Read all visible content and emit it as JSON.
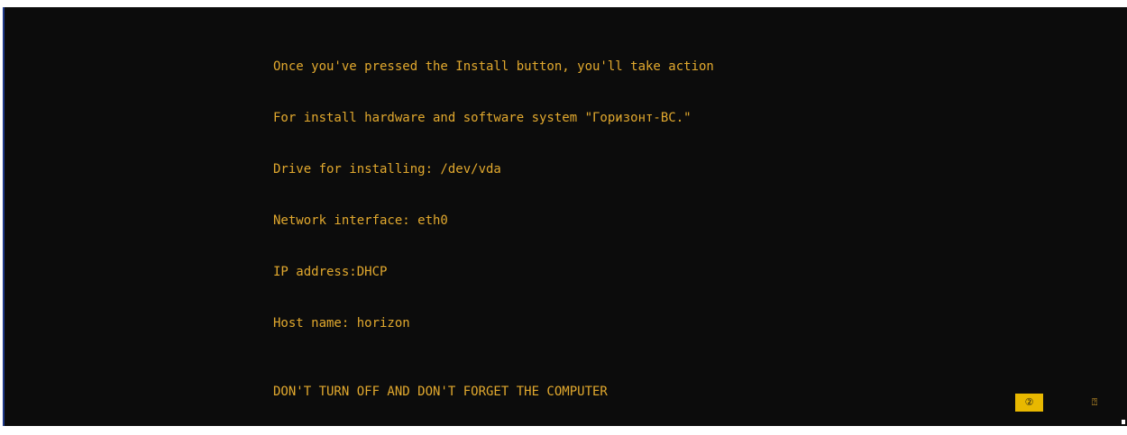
{
  "console": {
    "lines": [
      "Once you've pressed the Install button, you'll take action",
      "For install hardware and software system \"Горизонт-ВС.\"",
      "Drive for installing: /dev/vda",
      "Network interface: eth0",
      "IP address:DHCP",
      "Host name: horizon"
    ],
    "warning": "DON'T TURN OFF AND DON'T FORGET THE COMPUTER"
  },
  "status_bar": {
    "help_button_label": "②",
    "secondary_button_label": "⍰"
  },
  "colors": {
    "background": "#0c0c0c",
    "text": "#e2a92e",
    "accent_button": "#e8b800"
  }
}
